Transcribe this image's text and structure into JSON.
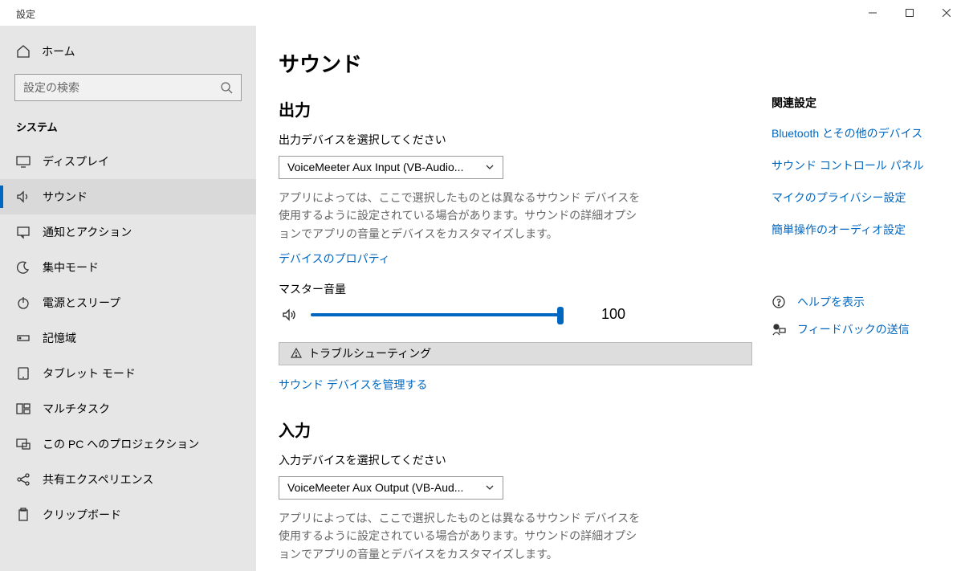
{
  "window": {
    "title": "設定"
  },
  "sidebar": {
    "home": "ホーム",
    "search_placeholder": "設定の検索",
    "section": "システム",
    "items": [
      {
        "label": "ディスプレイ",
        "icon": "display"
      },
      {
        "label": "サウンド",
        "icon": "sound",
        "selected": true
      },
      {
        "label": "通知とアクション",
        "icon": "notification"
      },
      {
        "label": "集中モード",
        "icon": "focus"
      },
      {
        "label": "電源とスリープ",
        "icon": "power"
      },
      {
        "label": "記憶域",
        "icon": "storage"
      },
      {
        "label": "タブレット モード",
        "icon": "tablet"
      },
      {
        "label": "マルチタスク",
        "icon": "multitask"
      },
      {
        "label": "この PC へのプロジェクション",
        "icon": "projection"
      },
      {
        "label": "共有エクスペリエンス",
        "icon": "share"
      },
      {
        "label": "クリップボード",
        "icon": "clipboard"
      }
    ]
  },
  "main": {
    "title": "サウンド",
    "output": {
      "heading": "出力",
      "select_label": "出力デバイスを選択してください",
      "selected_device": "VoiceMeeter Aux Input (VB-Audio...",
      "help": "アプリによっては、ここで選択したものとは異なるサウンド デバイスを使用するように設定されている場合があります。サウンドの詳細オプションでアプリの音量とデバイスをカスタマイズします。",
      "properties_link": "デバイスのプロパティ",
      "master_volume_label": "マスター音量",
      "volume_value": "100",
      "troubleshoot": "トラブルシューティング",
      "manage_link": "サウンド デバイスを管理する"
    },
    "input": {
      "heading": "入力",
      "select_label": "入力デバイスを選択してください",
      "selected_device": "VoiceMeeter Aux Output (VB-Aud...",
      "help": "アプリによっては、ここで選択したものとは異なるサウンド デバイスを使用するように設定されている場合があります。サウンドの詳細オプションでアプリの音量とデバイスをカスタマイズします。"
    }
  },
  "rail": {
    "related_heading": "関連設定",
    "links": [
      "Bluetooth とその他のデバイス",
      "サウンド コントロール パネル",
      "マイクのプライバシー設定",
      "簡単操作のオーディオ設定"
    ],
    "help": "ヘルプを表示",
    "feedback": "フィードバックの送信"
  }
}
